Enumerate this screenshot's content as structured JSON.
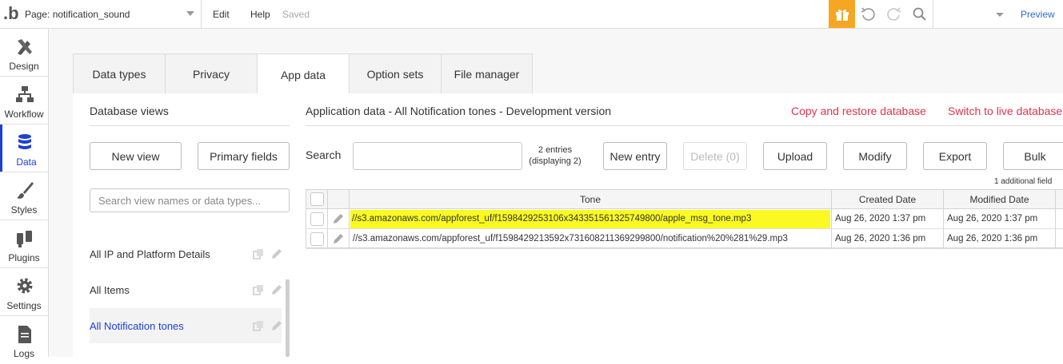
{
  "topbar": {
    "logo": ".b",
    "page_label": "Page: notification_sound",
    "edit": "Edit",
    "help": "Help",
    "saved": "Saved",
    "preview": "Preview",
    "accent_color": "#f5a623"
  },
  "sidebar": {
    "items": [
      {
        "label": "Design",
        "icon": "design-icon"
      },
      {
        "label": "Workflow",
        "icon": "workflow-icon"
      },
      {
        "label": "Data",
        "icon": "database-icon",
        "active": true
      },
      {
        "label": "Styles",
        "icon": "brush-icon"
      },
      {
        "label": "Plugins",
        "icon": "plug-icon"
      },
      {
        "label": "Settings",
        "icon": "gear-icon"
      },
      {
        "label": "Logs",
        "icon": "document-icon"
      }
    ],
    "active_color": "#1d3fd6"
  },
  "tabs": [
    "Data types",
    "Privacy",
    "App data",
    "Option sets",
    "File manager"
  ],
  "db_views": {
    "title": "Database views",
    "new_view": "New view",
    "primary_fields": "Primary fields",
    "search_placeholder": "Search view names or data types...",
    "items": [
      "All IP and Platform Details",
      "All Items",
      "All Notification tones"
    ]
  },
  "app_data": {
    "title": "Application data - All Notification tones - Development version",
    "copy_restore": "Copy and restore database",
    "switch_live": "Switch to live database",
    "search_label": "Search",
    "search_value": "",
    "entries_line1": "2 entries",
    "entries_line2": "(displaying 2)",
    "buttons": {
      "new_entry": "New entry",
      "delete": "Delete (0)",
      "upload": "Upload",
      "modify": "Modify",
      "export": "Export",
      "bulk": "Bulk"
    },
    "additional_fields": "1 additional field",
    "columns": [
      "Tone",
      "Created Date",
      "Modified Date"
    ],
    "rows": [
      {
        "tone": "//s3.amazonaws.com/appforest_uf/f1598429253106x343351561325749800/apple_msg_tone.mp3",
        "created": "Aug 26, 2020 1:37 pm",
        "modified": "Aug 26, 2020 1:37 pm",
        "highlighted": true
      },
      {
        "tone": "//s3.amazonaws.com/appforest_uf/f1598429213592x731608211369299800/notification%20%281%29.mp3",
        "created": "Aug 26, 2020 1:36 pm",
        "modified": "Aug 26, 2020 1:36 pm",
        "highlighted": false
      }
    ],
    "link_color": "#e0334f",
    "highlight_color": "#fafa22"
  }
}
